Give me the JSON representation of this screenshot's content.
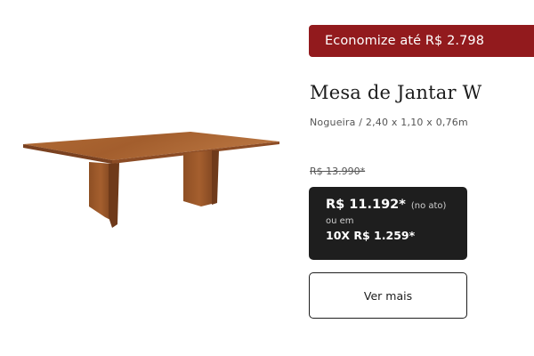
{
  "product": {
    "promo": "Economize até R$ 2.798",
    "title": "Mesa de Jantar W",
    "subtitle": "Nogueira / 2,40 x 1,10 x 0,76m",
    "old_price": "R$ 13.990*",
    "price": "R$ 11.192*",
    "price_note": "(no ato)",
    "installment_prefix": "ou em",
    "installment": "10X R$ 1.259*",
    "cta_label": "Ver mais"
  },
  "colors": {
    "promo_bg": "#921a1d",
    "price_box_bg": "#1e1e1e",
    "wood": "#a5612f"
  }
}
